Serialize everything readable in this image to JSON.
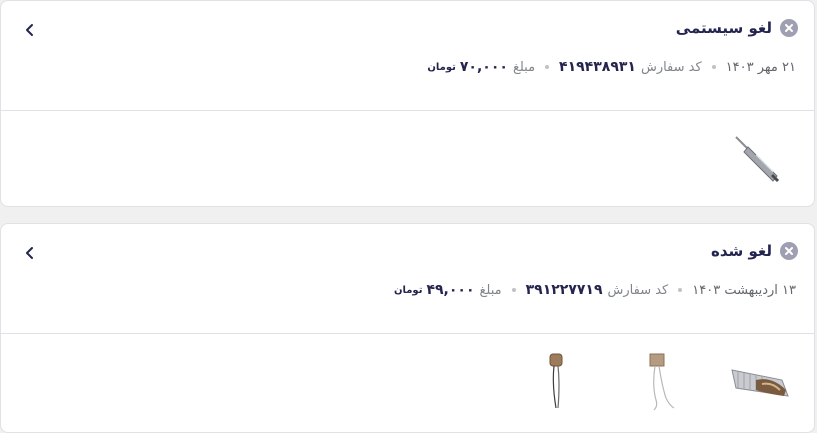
{
  "orders": [
    {
      "status": "لغو سیستمی",
      "date": "۲۱ مهر ۱۴۰۳",
      "code_label": "کد سفارش",
      "code": "۴۱۹۴۳۸۹۳۱",
      "amount_label": "مبلغ",
      "amount": "۷۰,۰۰۰",
      "currency": "تومان",
      "products": [
        "soldering-pen-thumbnail"
      ]
    },
    {
      "status": "لغو شده",
      "date": "۱۳ اردیبهشت ۱۴۰۳",
      "code_label": "کد سفارش",
      "code": "۳۹۱۲۲۷۷۱۹",
      "amount_label": "مبلغ",
      "amount": "۴۹,۰۰۰",
      "currency": "تومان",
      "products": [
        "heatsink-thumbnail",
        "sensor-thumbnail",
        "capacitor-thumbnail"
      ]
    }
  ],
  "icons": {
    "status": "close-circle-icon",
    "navigate": "chevron-left-icon"
  }
}
